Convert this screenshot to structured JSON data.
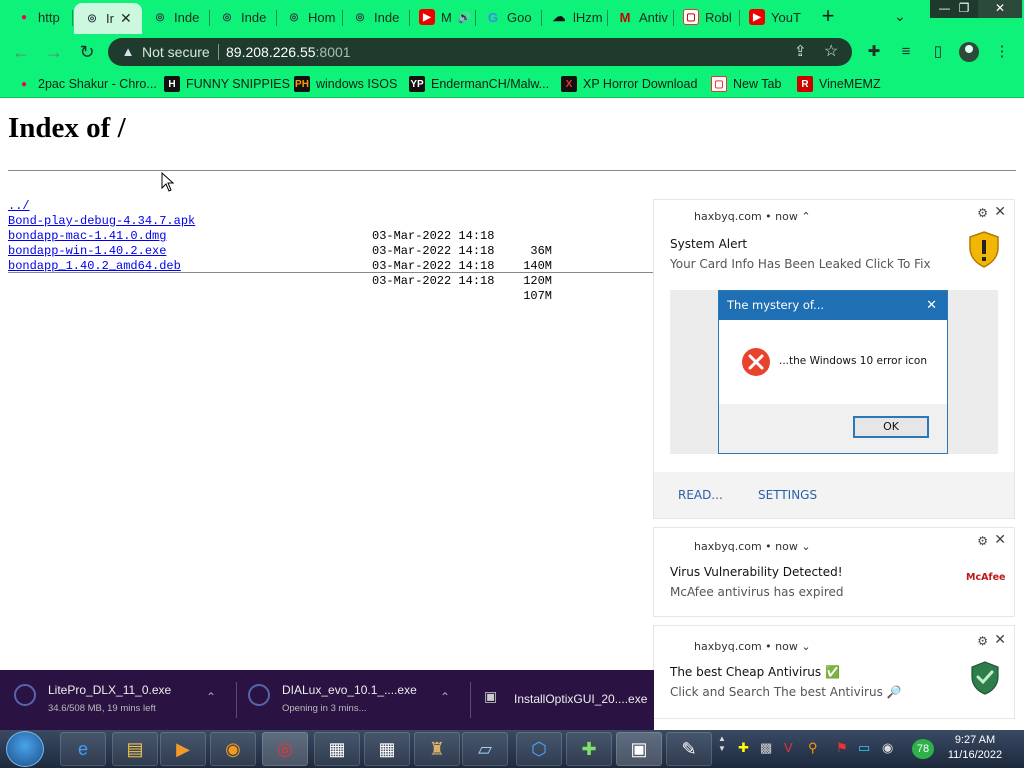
{
  "browser": {
    "tabs": [
      {
        "title": "http",
        "icon": "favicon-icon"
      },
      {
        "title": "Ir",
        "icon": "globe-icon",
        "active": true
      },
      {
        "title": "Inde",
        "icon": "globe-icon"
      },
      {
        "title": "Inde",
        "icon": "globe-icon"
      },
      {
        "title": "Hom",
        "icon": "globe-icon"
      },
      {
        "title": "Inde",
        "icon": "globe-icon"
      },
      {
        "title": "M",
        "icon": "youtube-icon"
      },
      {
        "title": "Goo",
        "icon": "google-icon"
      },
      {
        "title": "lHzm",
        "icon": "cloud-icon"
      },
      {
        "title": "Antiv",
        "icon": "mcafee-icon"
      },
      {
        "title": "Robl",
        "icon": "roblox-icon"
      },
      {
        "title": "YouT",
        "icon": "youtube-icon"
      }
    ],
    "address": {
      "security_label": "Not secure",
      "host": "89.208.226.55",
      "port": ":8001"
    },
    "bookmarks": [
      {
        "label": "2pac Shakur - Chro...",
        "icon": "bookmark-favicon-icon"
      },
      {
        "label": "FUNNY SNIPPIES",
        "icon": "h-icon"
      },
      {
        "label": "windows ISOS",
        "icon": "ph-icon"
      },
      {
        "label": "EndermanCH/Malw...",
        "icon": "yp-icon"
      },
      {
        "label": "XP Horror Download",
        "icon": "x-icon"
      },
      {
        "label": "New Tab",
        "icon": "lock-icon"
      },
      {
        "label": "VineMEMZ",
        "icon": "r-icon"
      }
    ]
  },
  "page": {
    "heading": "Index of /",
    "parent_link": "../",
    "files": [
      {
        "name": "Bond-play-debug-4.34.7.apk",
        "date": "03-Mar-2022 14:18",
        "size": "36M"
      },
      {
        "name": "bondapp-mac-1.41.0.dmg",
        "date": "03-Mar-2022 14:18",
        "size": "140M"
      },
      {
        "name": "bondapp-win-1.40.2.exe",
        "date": "03-Mar-2022 14:18",
        "size": "120M"
      },
      {
        "name": "bondapp_1.40.2_amd64.deb",
        "date": "03-Mar-2022 14:18",
        "size": "107M"
      }
    ]
  },
  "notifications": [
    {
      "source": "haxbyq.com • now ⌃",
      "title": "System Alert",
      "body": "Your Card Info Has Been Leaked Click To Fix",
      "icon": "shield-warning-icon",
      "image_dialog": {
        "title": "The mystery of...",
        "message": "...the Windows 10 error icon",
        "ok": "OK"
      },
      "actions": [
        "READ...",
        "SETTINGS"
      ]
    },
    {
      "source": "haxbyq.com • now ⌄",
      "title": "Virus Vulnerability Detected!",
      "body": "McAfee antivirus has expired",
      "icon": "mcafee-logo-icon",
      "logo_text": "McAfee"
    },
    {
      "source": "haxbyq.com • now ⌄",
      "title": "The best Cheap Antivirus ✅",
      "body": "Click and Search The best Antivirus 🔎",
      "icon": "green-shield-check-icon"
    }
  ],
  "downloads": [
    {
      "name": "LitePro_DLX_11_0.exe",
      "status": "34.6/508 MB, 19 mins left"
    },
    {
      "name": "DIALux_evo_10.1_....exe",
      "status": "Opening in 3 mins..."
    },
    {
      "name": "InstallOptixGUI_20....exe",
      "status": ""
    }
  ],
  "taskbar": {
    "tray_badge": "78",
    "time": "9:27 AM",
    "date": "11/16/2022"
  }
}
